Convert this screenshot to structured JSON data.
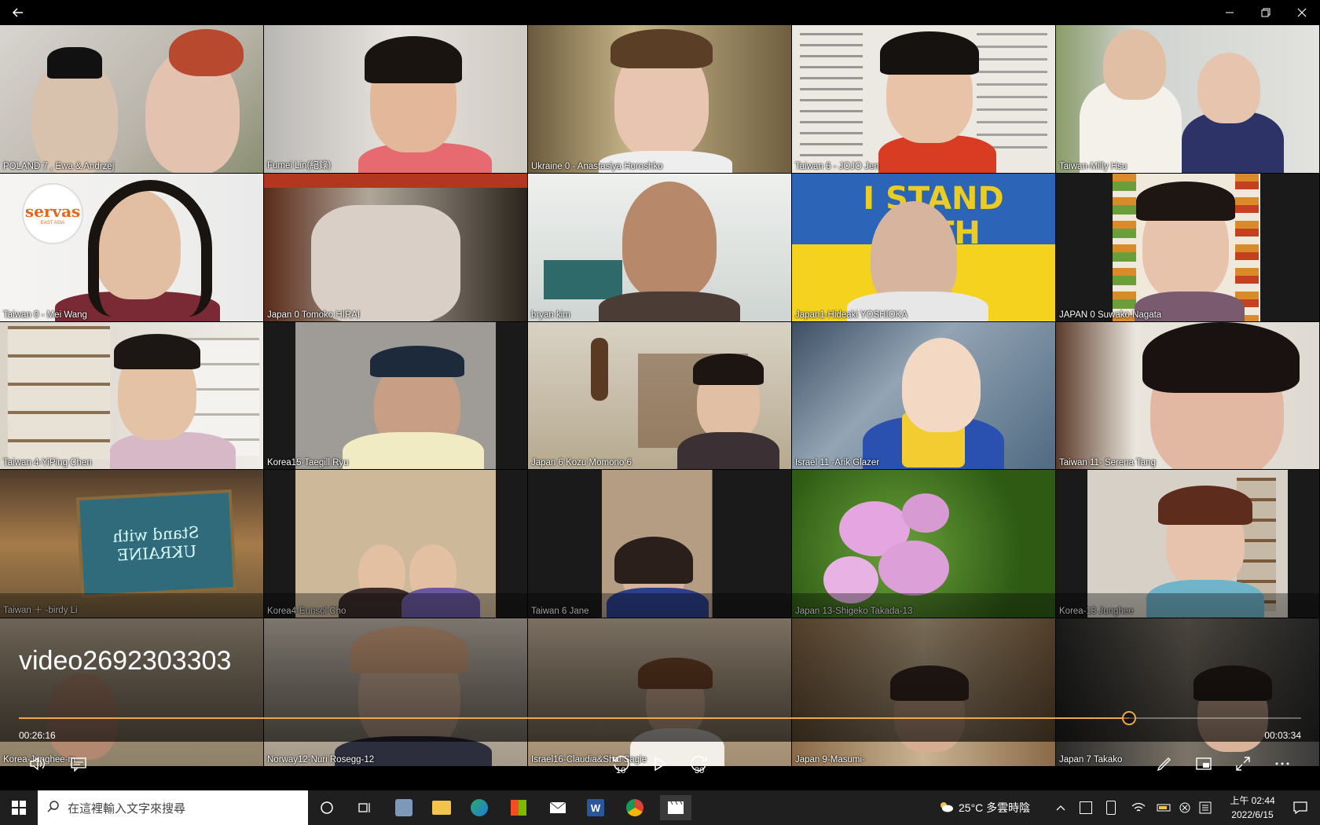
{
  "window": {
    "back_icon": "back-arrow-icon",
    "minimize_icon": "minimize-icon",
    "maximize_icon": "restore-icon",
    "close_icon": "close-icon"
  },
  "participants": [
    "POLAND 7 , Ewa & Andrzej",
    "Fumei Lin(紀錄)",
    "Ukraine 0 - Anastasiya Horoshko",
    "Taiwan 6 - JOJO Jen",
    "Taiwan-Milly Hsu",
    "Taiwan 0 - Mei Wang",
    "Japan 0 Tomoko HIRAI",
    "bryan kim",
    "Japan1-Hideaki YOSHIOKA",
    "JAPAN 0 Suwako Nagata",
    "Taiwan 4-YiPing Chen",
    "Korea15-Taegill Ryu",
    "Japan 6 Kozu Momono 6",
    "Israel 11 -Arik Glazer",
    "Taiwan  11-  Serena Tang",
    "Taiwan ＋ -birdy Li",
    "Korea4-Eunsol Cho",
    "Taiwan 6 Jane",
    "Japan 13-Shigeko Takada-13",
    "Korea-13 Junghee",
    "Korea-Junghee-m",
    "Norway12-Nuri Rosegg-12",
    "Israel16-Claudia&Shai Sagie",
    "Japan 9-Masumi-",
    "Japan 7 Takako"
  ],
  "banner_text": "I STAND WITH UKRAINE",
  "logo_text": "servas",
  "logo_subtext": "EAST ASIA",
  "chalkboard_text": "Stand with UKRAINE",
  "player": {
    "title": "video2692303303",
    "elapsed": "00:26:16",
    "remaining": "00:03:34",
    "progress": 0.866,
    "skip_back_label": "10",
    "skip_forward_label": "30",
    "accent_color": "#f0a84a"
  },
  "taskbar": {
    "search_placeholder": "在這裡輸入文字來搜尋",
    "weather": "25°C  多雲時陰",
    "time": "上午 02:44",
    "date": "2022/6/15"
  }
}
